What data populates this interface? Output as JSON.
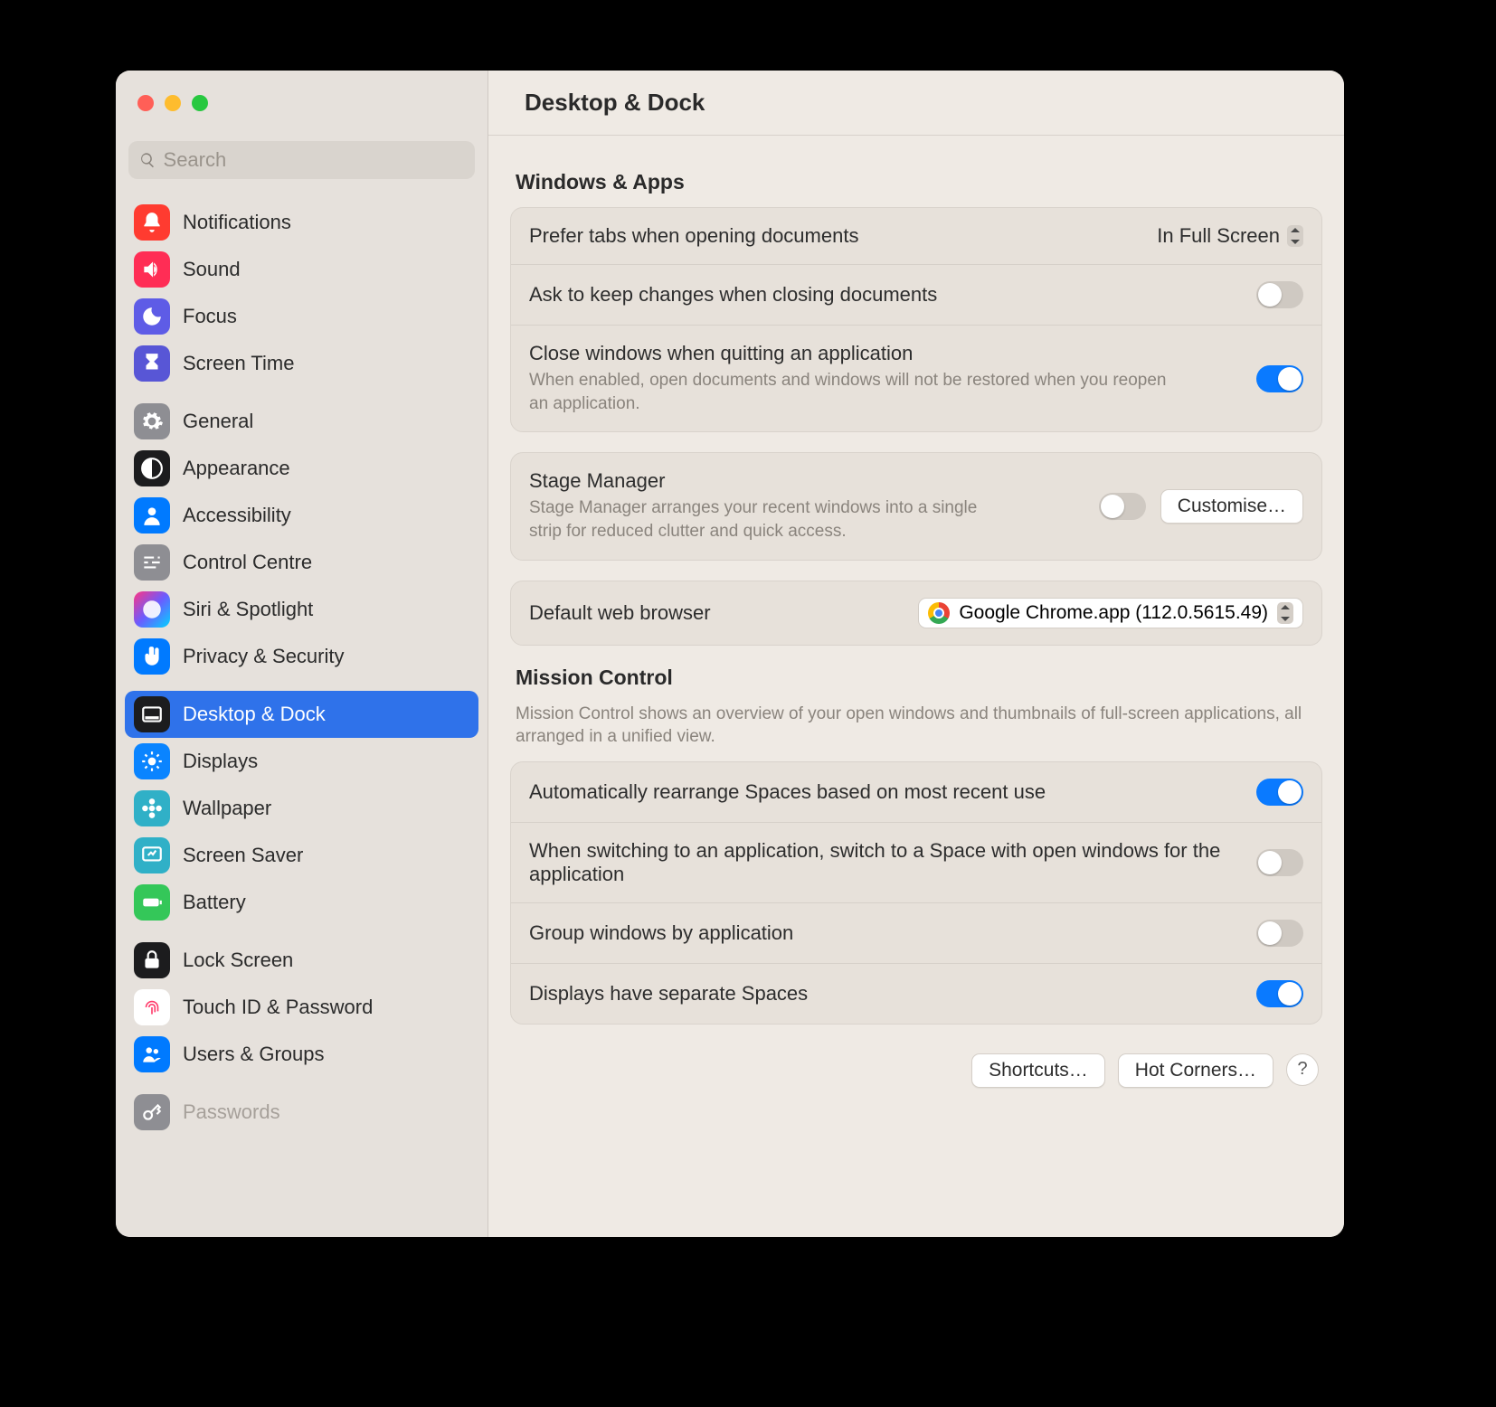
{
  "header": {
    "title": "Desktop & Dock"
  },
  "search": {
    "placeholder": "Search"
  },
  "sidebar": {
    "groups": [
      [
        {
          "label": "Notifications",
          "icon": "bell",
          "bg": "bg-red"
        },
        {
          "label": "Sound",
          "icon": "speaker",
          "bg": "bg-pink"
        },
        {
          "label": "Focus",
          "icon": "moon",
          "bg": "bg-indigo"
        },
        {
          "label": "Screen Time",
          "icon": "hourglass",
          "bg": "bg-indigo2"
        }
      ],
      [
        {
          "label": "General",
          "icon": "gear",
          "bg": "bg-gray"
        },
        {
          "label": "Appearance",
          "icon": "contrast",
          "bg": "bg-black"
        },
        {
          "label": "Accessibility",
          "icon": "person",
          "bg": "bg-blue"
        },
        {
          "label": "Control Centre",
          "icon": "sliders",
          "bg": "bg-gray"
        },
        {
          "label": "Siri & Spotlight",
          "icon": "siri",
          "bg": "bg-siri"
        },
        {
          "label": "Privacy & Security",
          "icon": "hand",
          "bg": "bg-blue"
        }
      ],
      [
        {
          "label": "Desktop & Dock",
          "icon": "dock",
          "bg": "bg-black",
          "selected": true
        },
        {
          "label": "Displays",
          "icon": "sun",
          "bg": "bg-blue2"
        },
        {
          "label": "Wallpaper",
          "icon": "flower",
          "bg": "bg-teal"
        },
        {
          "label": "Screen Saver",
          "icon": "screensaver",
          "bg": "bg-teal"
        },
        {
          "label": "Battery",
          "icon": "battery",
          "bg": "bg-green"
        }
      ],
      [
        {
          "label": "Lock Screen",
          "icon": "lock",
          "bg": "bg-black"
        },
        {
          "label": "Touch ID & Password",
          "icon": "fingerprint",
          "bg": "bg-white-fp"
        },
        {
          "label": "Users & Groups",
          "icon": "users",
          "bg": "bg-blue"
        }
      ],
      [
        {
          "label": "Passwords",
          "icon": "key",
          "bg": "bg-key",
          "faded": true
        }
      ]
    ]
  },
  "windowsApps": {
    "title": "Windows & Apps",
    "preferTabs": {
      "label": "Prefer tabs when opening documents",
      "value": "In Full Screen"
    },
    "askKeep": {
      "label": "Ask to keep changes when closing documents",
      "on": false
    },
    "closeWindows": {
      "label": "Close windows when quitting an application",
      "desc": "When enabled, open documents and windows will not be restored when you reopen an application.",
      "on": true
    }
  },
  "stageManager": {
    "label": "Stage Manager",
    "desc": "Stage Manager arranges your recent windows into a single strip for reduced clutter and quick access.",
    "on": false,
    "customise": "Customise…"
  },
  "browser": {
    "label": "Default web browser",
    "value": "Google Chrome.app (112.0.5615.49)"
  },
  "missionControl": {
    "title": "Mission Control",
    "desc": "Mission Control shows an overview of your open windows and thumbnails of full-screen applications, all arranged in a unified view.",
    "autoRearrange": {
      "label": "Automatically rearrange Spaces based on most recent use",
      "on": true
    },
    "switchSpace": {
      "label": "When switching to an application, switch to a Space with open windows for the application",
      "on": false
    },
    "groupWindows": {
      "label": "Group windows by application",
      "on": false
    },
    "separateSpaces": {
      "label": "Displays have separate Spaces",
      "on": true
    }
  },
  "footer": {
    "shortcuts": "Shortcuts…",
    "hotCorners": "Hot Corners…",
    "help": "?"
  }
}
